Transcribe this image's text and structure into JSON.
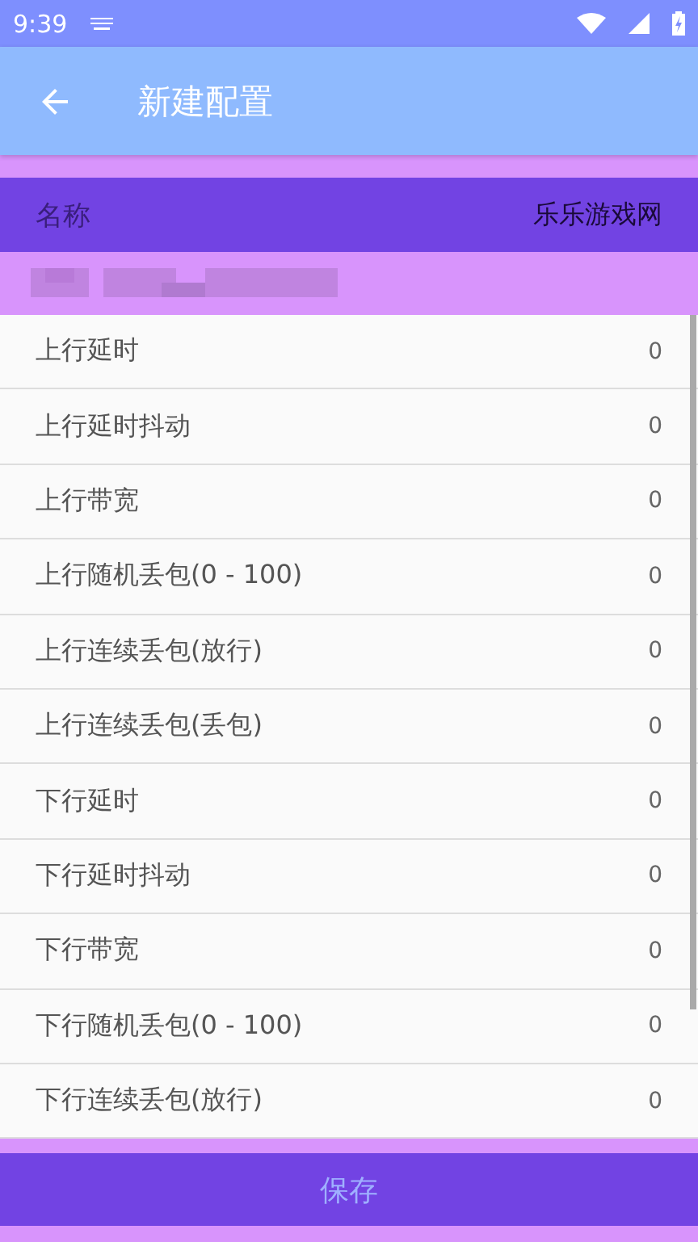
{
  "status_bar": {
    "time": "9:39"
  },
  "app_bar": {
    "title": "新建配置"
  },
  "name_row": {
    "label": "名称",
    "value": "乐乐游戏网"
  },
  "settings": [
    {
      "label": "上行延时",
      "value": "0"
    },
    {
      "label": "上行延时抖动",
      "value": "0"
    },
    {
      "label": "上行带宽",
      "value": "0"
    },
    {
      "label": "上行随机丢包(0 - 100)",
      "value": "0"
    },
    {
      "label": "上行连续丢包(放行)",
      "value": "0"
    },
    {
      "label": "上行连续丢包(丢包)",
      "value": "0"
    },
    {
      "label": "下行延时",
      "value": "0"
    },
    {
      "label": "下行延时抖动",
      "value": "0"
    },
    {
      "label": "下行带宽",
      "value": "0"
    },
    {
      "label": "下行随机丢包(0 - 100)",
      "value": "0"
    },
    {
      "label": "下行连续丢包(放行)",
      "value": "0"
    }
  ],
  "save_button": {
    "label": "保存"
  }
}
